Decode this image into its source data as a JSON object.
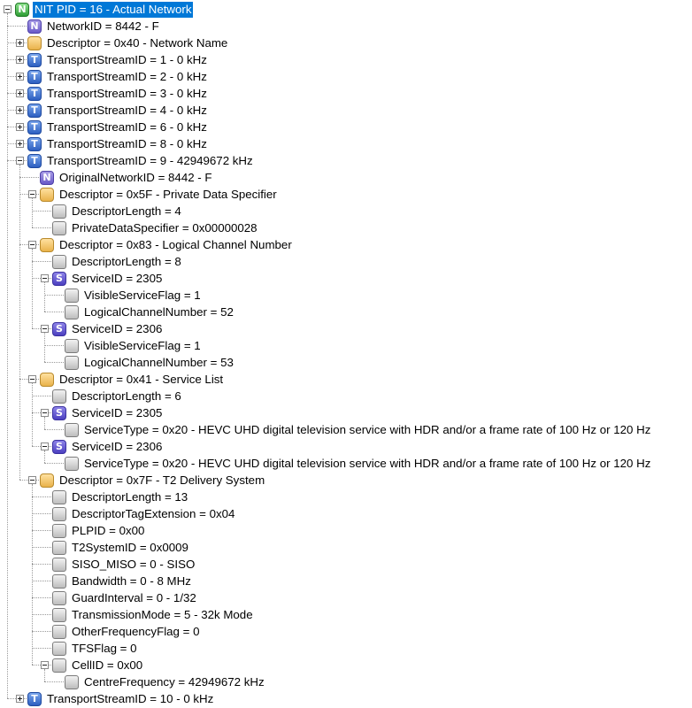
{
  "tree": [
    {
      "d": 0,
      "icon": "N",
      "color": "green",
      "expander": "minus",
      "text": "NIT PID = 16 - Actual Network",
      "selected": true
    },
    {
      "d": 1,
      "icon": "N",
      "text": "NetworkID = 8442 - F"
    },
    {
      "d": 1,
      "icon": "D",
      "expander": "plus",
      "text": "Descriptor = 0x40 - Network Name"
    },
    {
      "d": 1,
      "icon": "T",
      "expander": "plus",
      "text": "TransportStreamID = 1 - 0 kHz"
    },
    {
      "d": 1,
      "icon": "T",
      "expander": "plus",
      "text": "TransportStreamID = 2 - 0 kHz"
    },
    {
      "d": 1,
      "icon": "T",
      "expander": "plus",
      "text": "TransportStreamID = 3 - 0 kHz"
    },
    {
      "d": 1,
      "icon": "T",
      "expander": "plus",
      "text": "TransportStreamID = 4 - 0 kHz"
    },
    {
      "d": 1,
      "icon": "T",
      "expander": "plus",
      "text": "TransportStreamID = 6 - 0 kHz"
    },
    {
      "d": 1,
      "icon": "T",
      "expander": "plus",
      "text": "TransportStreamID = 8 - 0 kHz"
    },
    {
      "d": 1,
      "icon": "T",
      "expander": "minus",
      "text": "TransportStreamID = 9 - 42949672 kHz"
    },
    {
      "d": 2,
      "icon": "N",
      "text": "OriginalNetworkID = 8442 - F"
    },
    {
      "d": 2,
      "icon": "D",
      "expander": "minus",
      "text": "Descriptor = 0x5F - Private Data Specifier"
    },
    {
      "d": 3,
      "icon": "G",
      "text": "DescriptorLength = 4"
    },
    {
      "d": 3,
      "icon": "G",
      "text": "PrivateDataSpecifier = 0x00000028"
    },
    {
      "d": 2,
      "icon": "D",
      "expander": "minus",
      "text": "Descriptor = 0x83 - Logical Channel Number"
    },
    {
      "d": 3,
      "icon": "G",
      "text": "DescriptorLength = 8"
    },
    {
      "d": 3,
      "icon": "S",
      "expander": "minus",
      "text": "ServiceID = 2305"
    },
    {
      "d": 4,
      "icon": "G",
      "text": "VisibleServiceFlag = 1"
    },
    {
      "d": 4,
      "icon": "G",
      "text": "LogicalChannelNumber = 52"
    },
    {
      "d": 3,
      "icon": "S",
      "expander": "minus",
      "text": "ServiceID = 2306"
    },
    {
      "d": 4,
      "icon": "G",
      "text": "VisibleServiceFlag = 1"
    },
    {
      "d": 4,
      "icon": "G",
      "text": "LogicalChannelNumber = 53"
    },
    {
      "d": 2,
      "icon": "D",
      "expander": "minus",
      "text": "Descriptor = 0x41 - Service List"
    },
    {
      "d": 3,
      "icon": "G",
      "text": "DescriptorLength = 6"
    },
    {
      "d": 3,
      "icon": "S",
      "expander": "minus",
      "text": "ServiceID = 2305"
    },
    {
      "d": 4,
      "icon": "G",
      "text": "ServiceType = 0x20 - HEVC UHD digital television service with HDR and/or a frame rate of 100 Hz or 120 Hz"
    },
    {
      "d": 3,
      "icon": "S",
      "expander": "minus",
      "text": "ServiceID = 2306"
    },
    {
      "d": 4,
      "icon": "G",
      "text": "ServiceType = 0x20 - HEVC UHD digital television service with HDR and/or a frame rate of 100 Hz or 120 Hz"
    },
    {
      "d": 2,
      "icon": "D",
      "expander": "minus",
      "text": "Descriptor = 0x7F - T2 Delivery System"
    },
    {
      "d": 3,
      "icon": "G",
      "text": "DescriptorLength = 13"
    },
    {
      "d": 3,
      "icon": "G",
      "text": "DescriptorTagExtension = 0x04"
    },
    {
      "d": 3,
      "icon": "G",
      "text": "PLPID = 0x00"
    },
    {
      "d": 3,
      "icon": "G",
      "text": "T2SystemID = 0x0009"
    },
    {
      "d": 3,
      "icon": "G",
      "text": "SISO_MISO = 0 - SISO"
    },
    {
      "d": 3,
      "icon": "G",
      "text": "Bandwidth = 0 - 8 MHz"
    },
    {
      "d": 3,
      "icon": "G",
      "text": "GuardInterval = 0 - 1/32"
    },
    {
      "d": 3,
      "icon": "G",
      "text": "TransmissionMode = 5 - 32k Mode"
    },
    {
      "d": 3,
      "icon": "G",
      "text": "OtherFrequencyFlag = 0"
    },
    {
      "d": 3,
      "icon": "G",
      "text": "TFSFlag = 0"
    },
    {
      "d": 3,
      "icon": "G",
      "expander": "minus",
      "text": "CellID = 0x00"
    },
    {
      "d": 4,
      "icon": "G",
      "text": "CentreFrequency = 42949672 kHz"
    },
    {
      "d": 1,
      "icon": "T",
      "expander": "plus",
      "text": "TransportStreamID = 10 - 0 kHz"
    }
  ],
  "colors": {
    "selection": "#0078d7",
    "connector": "#9a9a9a"
  }
}
